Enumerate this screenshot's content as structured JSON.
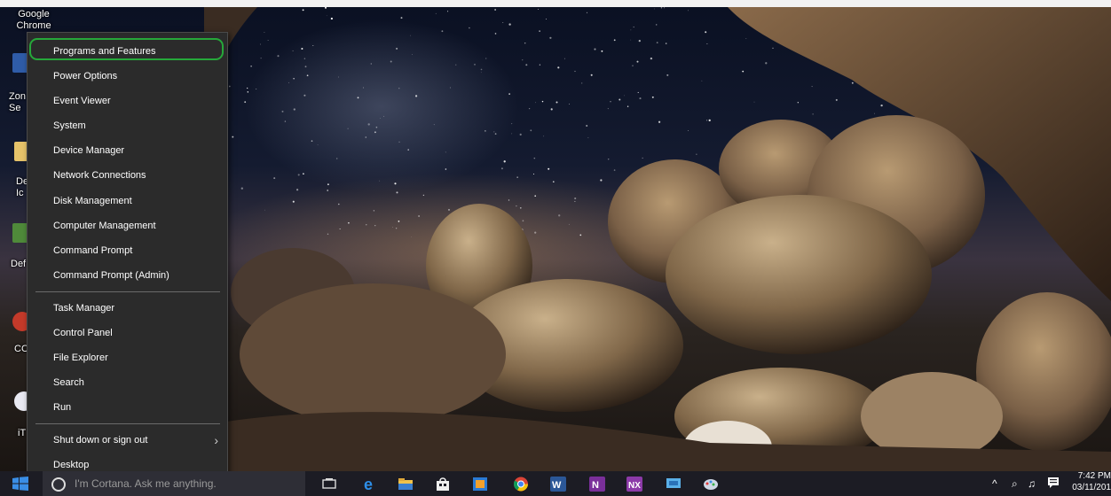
{
  "desktop": {
    "icons": [
      {
        "label": "Google\nChrome"
      },
      {
        "label": "Zon\nSe"
      },
      {
        "label": "De\nIc"
      },
      {
        "label": "Def"
      },
      {
        "label": "CC"
      },
      {
        "label": "iT"
      }
    ]
  },
  "winx_menu": {
    "items": [
      {
        "label": "Programs and Features"
      },
      {
        "label": "Power Options"
      },
      {
        "label": "Event Viewer"
      },
      {
        "label": "System"
      },
      {
        "label": "Device Manager"
      },
      {
        "label": "Network Connections"
      },
      {
        "label": "Disk Management"
      },
      {
        "label": "Computer Management"
      },
      {
        "label": "Command Prompt"
      },
      {
        "label": "Command Prompt (Admin)"
      },
      {
        "label": "Task Manager"
      },
      {
        "label": "Control Panel"
      },
      {
        "label": "File Explorer"
      },
      {
        "label": "Search"
      },
      {
        "label": "Run"
      },
      {
        "label": "Shut down or sign out"
      },
      {
        "label": "Desktop"
      }
    ],
    "highlighted_item": "Programs and Features",
    "highlight_color": "#26a83a"
  },
  "taskbar": {
    "search_placeholder": "I'm Cortana. Ask me anything.",
    "pinned_icons": [
      "task-view-icon",
      "edge-icon",
      "file-explorer-icon",
      "store-icon",
      "media-player-icon",
      "chrome-icon",
      "word-icon",
      "onenote-icon",
      "onenote-x-icon",
      "remote-desktop-icon",
      "paint-icon"
    ],
    "tray": {
      "chevron": "^",
      "time": "7:42 PM",
      "date": "03/11/201"
    }
  }
}
